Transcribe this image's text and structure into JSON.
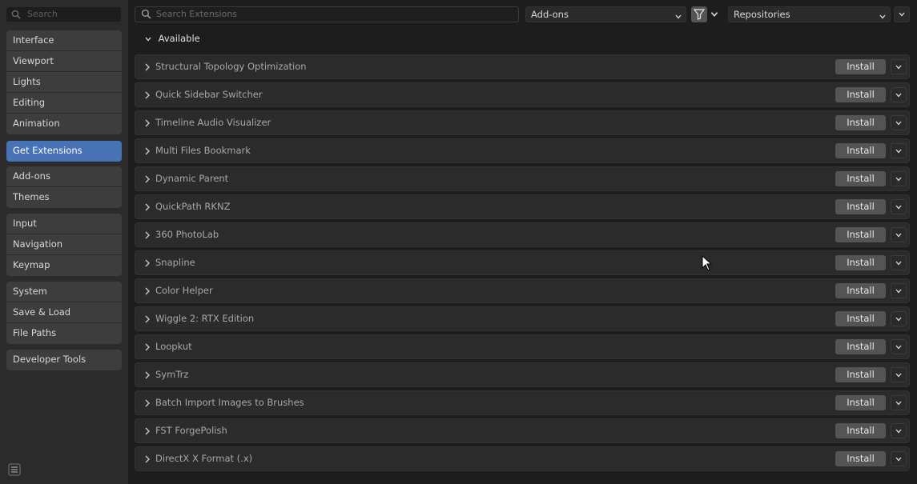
{
  "sidebar": {
    "search_placeholder": "Search",
    "groups": [
      [
        "Interface",
        "Viewport",
        "Lights",
        "Editing",
        "Animation"
      ],
      [
        "Get Extensions"
      ],
      [
        "Add-ons",
        "Themes"
      ],
      [
        "Input",
        "Navigation",
        "Keymap"
      ],
      [
        "System",
        "Save & Load",
        "File Paths"
      ],
      [
        "Developer Tools"
      ]
    ],
    "active": "Get Extensions"
  },
  "topbar": {
    "search_placeholder": "Search Extensions",
    "type_dropdown": "Add-ons",
    "repo_dropdown": "Repositories"
  },
  "section": {
    "label": "Available"
  },
  "install_label": "Install",
  "extensions": [
    "Structural Topology Optimization",
    "Quick Sidebar Switcher",
    "Timeline Audio Visualizer",
    "Multi Files Bookmark",
    "Dynamic Parent",
    "QuickPath RKNZ",
    "360 PhotoLab",
    "Snapline",
    "Color Helper",
    "Wiggle 2: RTX Edition",
    "Loopkut",
    "SymTrz",
    "Batch Import Images to Brushes",
    "FST ForgePolish",
    "DirectX X Format (.x)"
  ],
  "colors": {
    "accent": "#4772b3",
    "panel": "#2b2b2b",
    "button": "#545454"
  },
  "icons": [
    "search-icon",
    "filter-icon",
    "chevron-down-icon",
    "chevron-right-icon",
    "menu-icon",
    "cursor-icon"
  ]
}
